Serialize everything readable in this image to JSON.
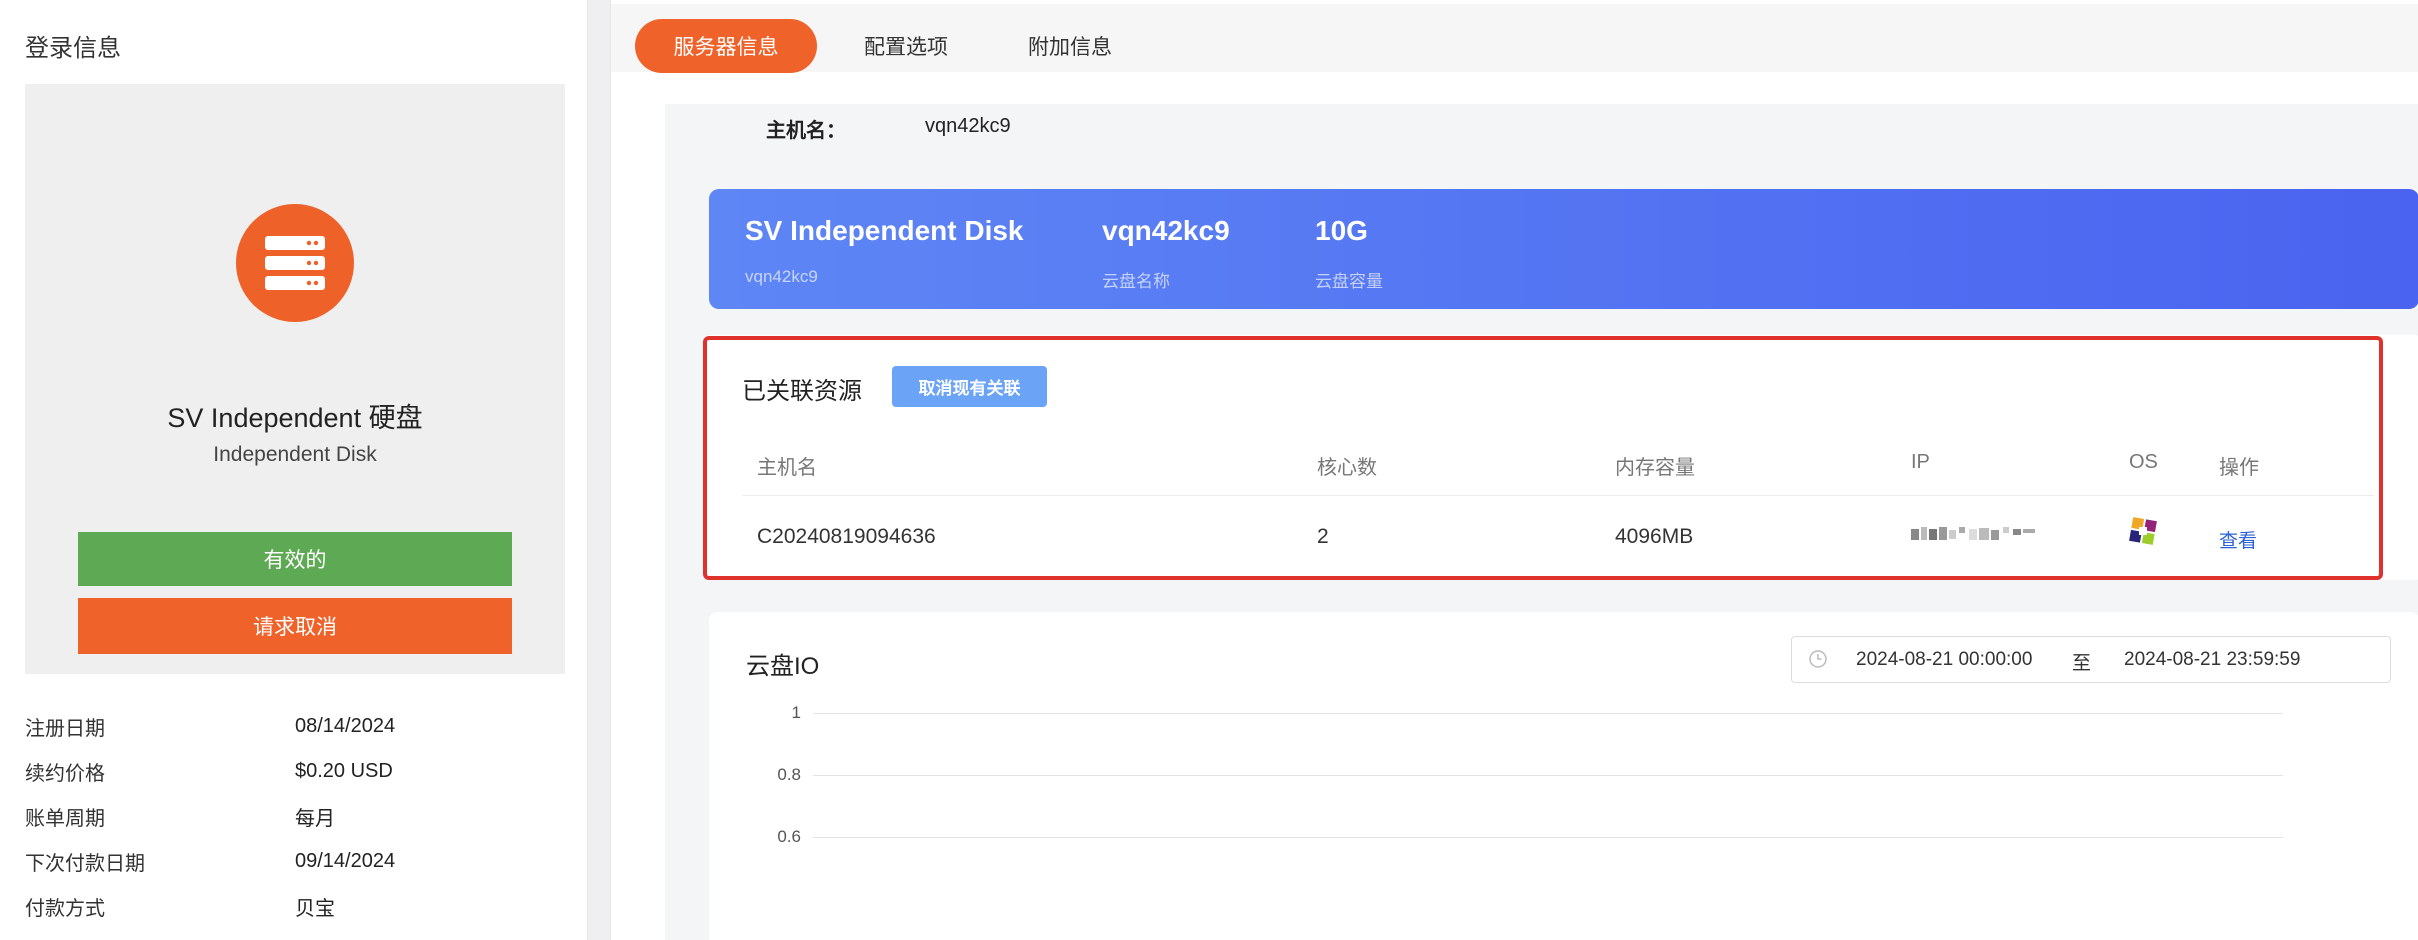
{
  "left": {
    "title": "登录信息",
    "product_name": "SV Independent 硬盘",
    "product_sub": "Independent Disk",
    "status_label": "有效的",
    "cancel_label": "请求取消",
    "info": [
      {
        "label": "注册日期",
        "value": "08/14/2024"
      },
      {
        "label": "续约价格",
        "value": "$0.20 USD"
      },
      {
        "label": "账单周期",
        "value": "每月"
      },
      {
        "label": "下次付款日期",
        "value": "09/14/2024"
      },
      {
        "label": "付款方式",
        "value": "贝宝"
      }
    ]
  },
  "tabs": [
    {
      "label": "服务器信息",
      "active": true
    },
    {
      "label": "配置选项",
      "active": false
    },
    {
      "label": "附加信息",
      "active": false
    }
  ],
  "host": {
    "label": "主机名：",
    "value": "vqn42kc9"
  },
  "disk": {
    "name": "SV Independent Disk",
    "name_sub": "vqn42kc9",
    "disk_name": "vqn42kc9",
    "disk_name_label": "云盘名称",
    "capacity": "10G",
    "capacity_label": "云盘容量"
  },
  "associated": {
    "title": "已关联资源",
    "unlink_button": "取消现有关联",
    "headers": [
      "主机名",
      "核心数",
      "内存容量",
      "IP",
      "OS",
      "操作"
    ],
    "row": {
      "hostname": "C20240819094636",
      "cores": "2",
      "memory": "4096MB",
      "action": "查看"
    }
  },
  "io": {
    "title": "云盘IO",
    "start": "2024-08-21 00:00:00",
    "to": "至",
    "end": "2024-08-21 23:59:59",
    "yticks": [
      "1",
      "0.8",
      "0.6"
    ]
  },
  "colors": {
    "accent": "#ef6229",
    "active_green": "#5ea954",
    "banner_blue": "#4a63f0",
    "highlight_red": "#e0322c"
  },
  "chart_data": {
    "type": "line",
    "title": "云盘IO",
    "xlabel": "",
    "ylabel": "",
    "series": [],
    "yticks": [
      1,
      0.8,
      0.6
    ],
    "grid": true
  }
}
